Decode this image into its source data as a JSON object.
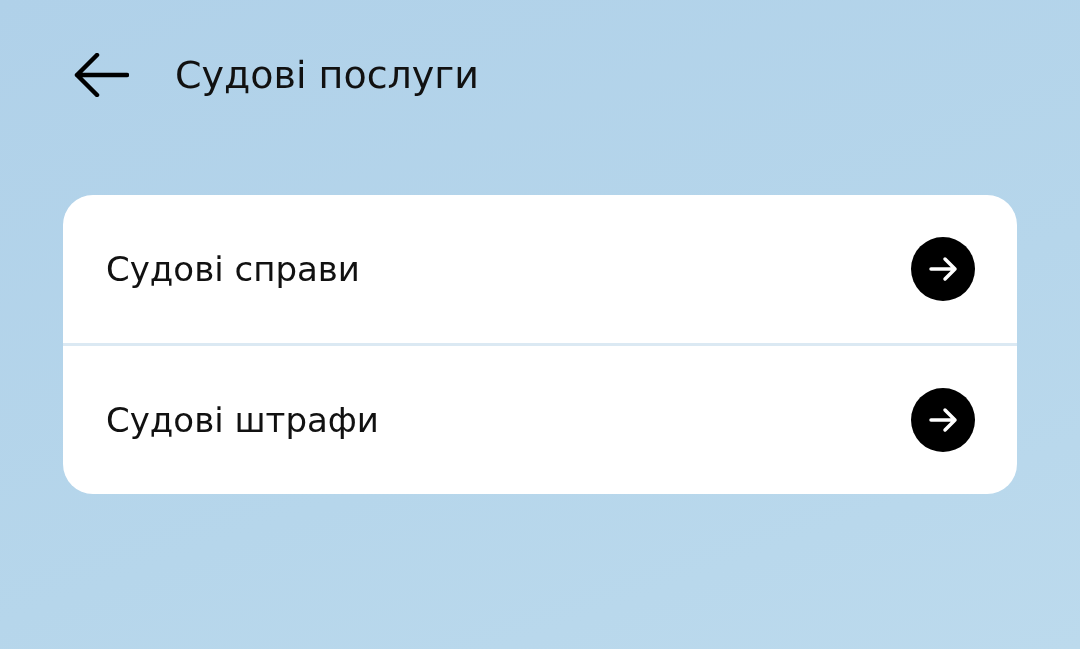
{
  "header": {
    "title": "Судові послуги"
  },
  "items": [
    {
      "label": "Судові справи"
    },
    {
      "label": "Судові штрафи"
    }
  ]
}
